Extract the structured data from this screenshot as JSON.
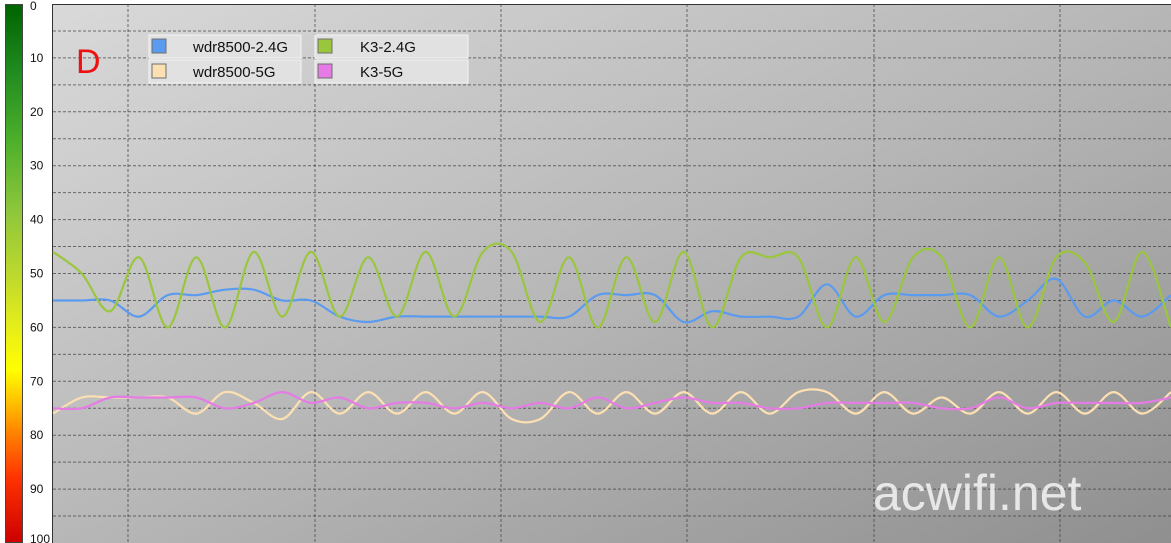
{
  "chart_data": {
    "type": "line",
    "title": "",
    "annotation": "D",
    "watermark": "acwifi.net",
    "ylim": [
      0,
      100
    ],
    "y_inverted": true,
    "yticks": [
      "0",
      "10",
      "20",
      "30",
      "40",
      "50",
      "60",
      "70",
      "80",
      "90",
      "100"
    ],
    "x_count": 40,
    "grid": true,
    "legend_position": "top-left",
    "series": [
      {
        "name": "wdr8500-2.4G",
        "color": "#5b9bef",
        "values": [
          55,
          55,
          55,
          58,
          54,
          54,
          53,
          53,
          55,
          55,
          58,
          59,
          58,
          58,
          58,
          58,
          58,
          58,
          58,
          54,
          54,
          54,
          59,
          57,
          58,
          58,
          58,
          52,
          58,
          54,
          54,
          54,
          54,
          58,
          55,
          51,
          58,
          55,
          58,
          54
        ]
      },
      {
        "name": "K3-2.4G",
        "color": "#9ac63d",
        "values": [
          46,
          50,
          57,
          47,
          60,
          47,
          60,
          46,
          58,
          46,
          58,
          47,
          58,
          46,
          58,
          46,
          46,
          59,
          47,
          60,
          47,
          59,
          46,
          60,
          47,
          47,
          47,
          60,
          47,
          59,
          47,
          47,
          60,
          47,
          60,
          47,
          48,
          59,
          46,
          60
        ]
      },
      {
        "name": "wdr8500-5G",
        "color": "#fde0b2",
        "values": [
          76,
          73,
          73,
          73,
          73,
          76,
          72,
          74,
          77,
          72,
          76,
          72,
          76,
          72,
          76,
          72,
          77,
          77,
          72,
          76,
          72,
          76,
          72,
          76,
          72,
          76,
          72,
          72,
          76,
          72,
          76,
          73,
          76,
          72,
          76,
          72,
          76,
          72,
          76,
          72
        ]
      },
      {
        "name": "K3-5G",
        "color": "#e67be6",
        "values": [
          75,
          75,
          73,
          73,
          73,
          73,
          75,
          74,
          72,
          74,
          73,
          75,
          74,
          74,
          75,
          74,
          75,
          74,
          75,
          73,
          75,
          74,
          73,
          74,
          74,
          75,
          75,
          74,
          74,
          74,
          74,
          75,
          75,
          73,
          75,
          74,
          74,
          74,
          74,
          73
        ]
      }
    ]
  }
}
